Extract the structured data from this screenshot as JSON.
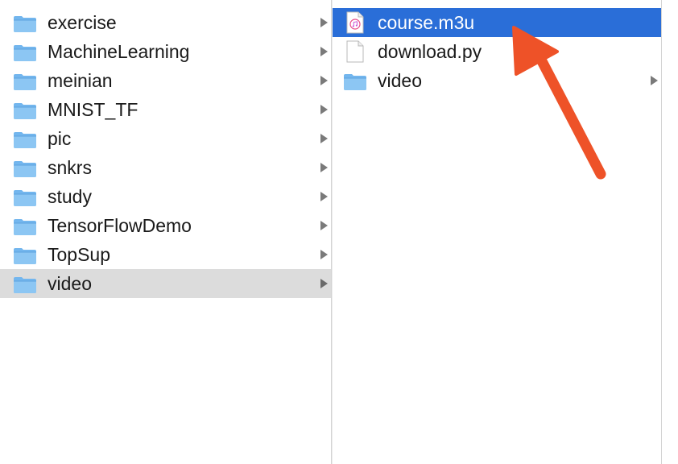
{
  "left_column": {
    "items": [
      {
        "label": "exercise",
        "icon": "folder-icon"
      },
      {
        "label": "MachineLearning",
        "icon": "folder-icon"
      },
      {
        "label": "meinian",
        "icon": "folder-icon"
      },
      {
        "label": "MNIST_TF",
        "icon": "folder-icon"
      },
      {
        "label": "pic",
        "icon": "folder-icon"
      },
      {
        "label": "snkrs",
        "icon": "folder-icon"
      },
      {
        "label": "study",
        "icon": "folder-icon"
      },
      {
        "label": "TensorFlowDemo",
        "icon": "folder-icon"
      },
      {
        "label": "TopSup",
        "icon": "folder-icon"
      },
      {
        "label": "video",
        "icon": "folder-icon",
        "selected": true
      }
    ]
  },
  "right_column": {
    "items": [
      {
        "label": "course.m3u",
        "icon": "music-playlist-file-icon",
        "selected": true
      },
      {
        "label": "download.py",
        "icon": "document-file-icon"
      },
      {
        "label": "video",
        "icon": "folder-icon"
      }
    ]
  },
  "colors": {
    "selection_blue": "#2a6ed8",
    "selection_gray": "#dcdcdc",
    "folder_blue": "#73b6ee",
    "annotation_arrow": "#ee5228"
  },
  "annotation": {
    "icon": "arrow-annotation-icon"
  }
}
